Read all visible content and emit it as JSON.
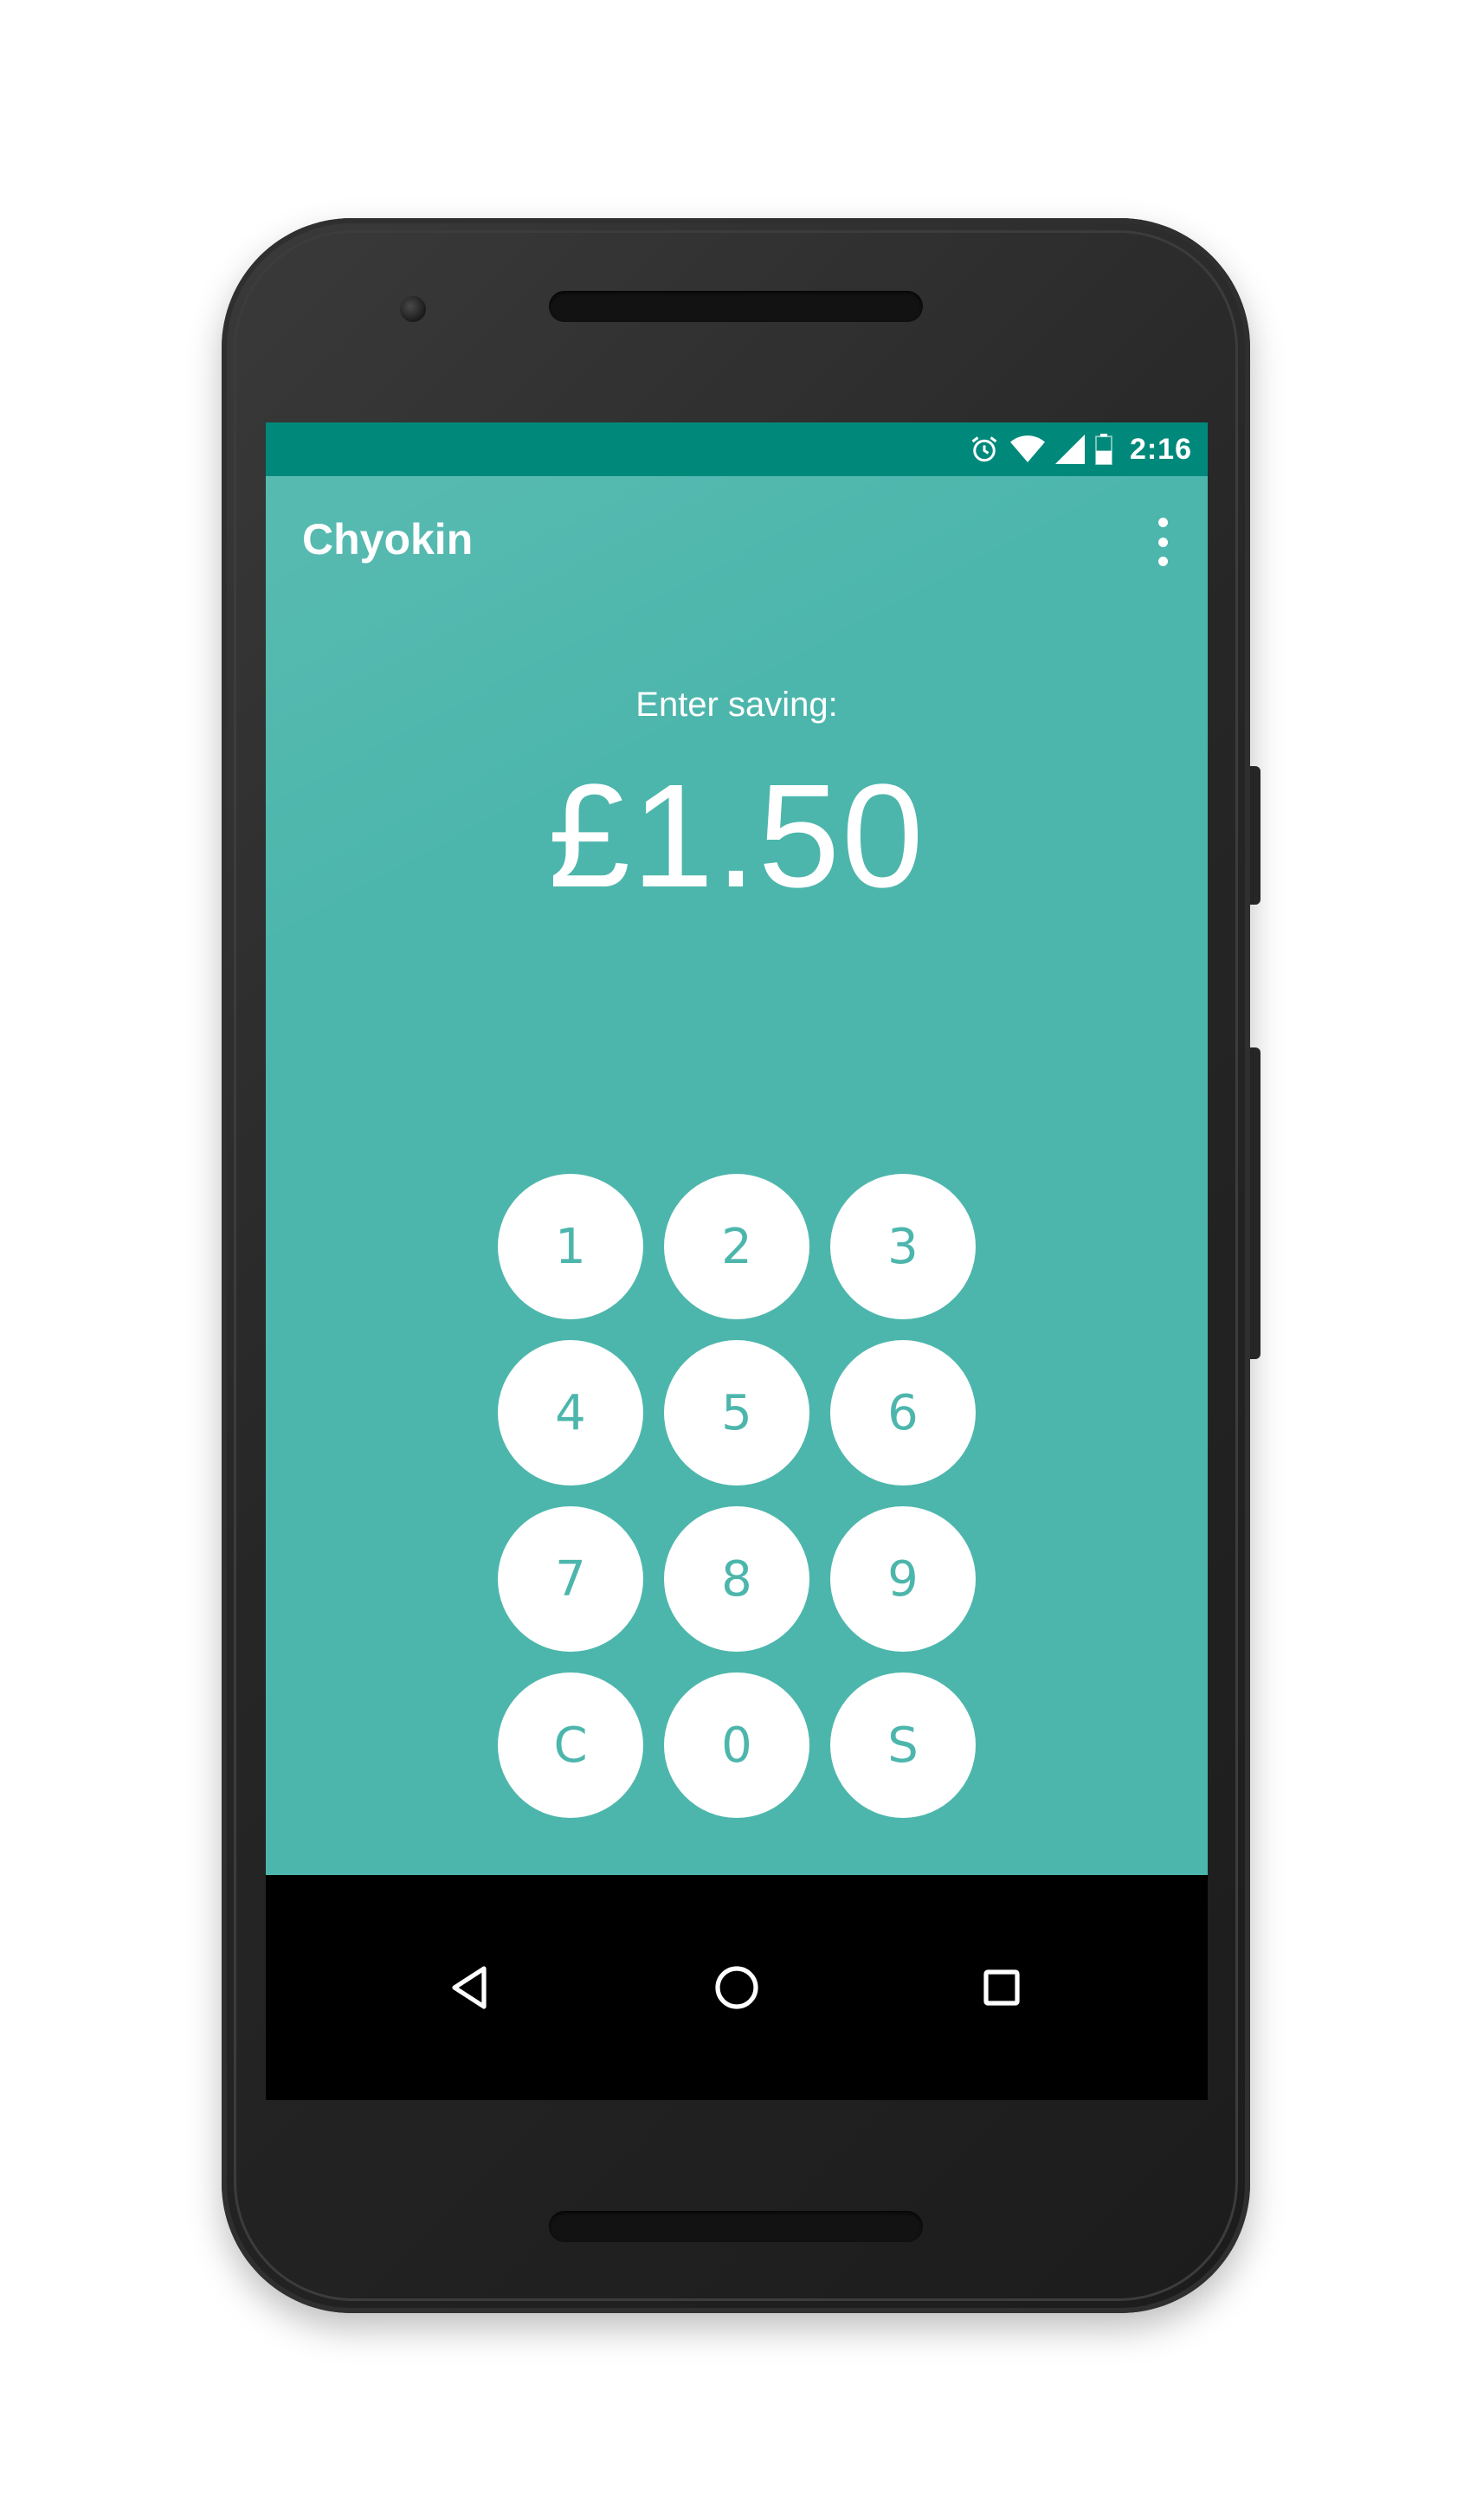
{
  "status_bar": {
    "time": "2:16",
    "icons": [
      "alarm-icon",
      "wifi-icon",
      "signal-icon",
      "battery-icon"
    ],
    "color": "#00897b"
  },
  "app": {
    "title": "Chyokin",
    "accent_color": "#4db6ac",
    "overflow_icon": "more-vert-icon"
  },
  "main": {
    "prompt": "Enter saving:",
    "amount": "£1.50"
  },
  "keypad": {
    "keys": [
      "1",
      "2",
      "3",
      "4",
      "5",
      "6",
      "7",
      "8",
      "9",
      "C",
      "0",
      "S"
    ]
  },
  "nav_bar": {
    "icons": [
      "back-icon",
      "home-icon",
      "recents-icon"
    ]
  }
}
